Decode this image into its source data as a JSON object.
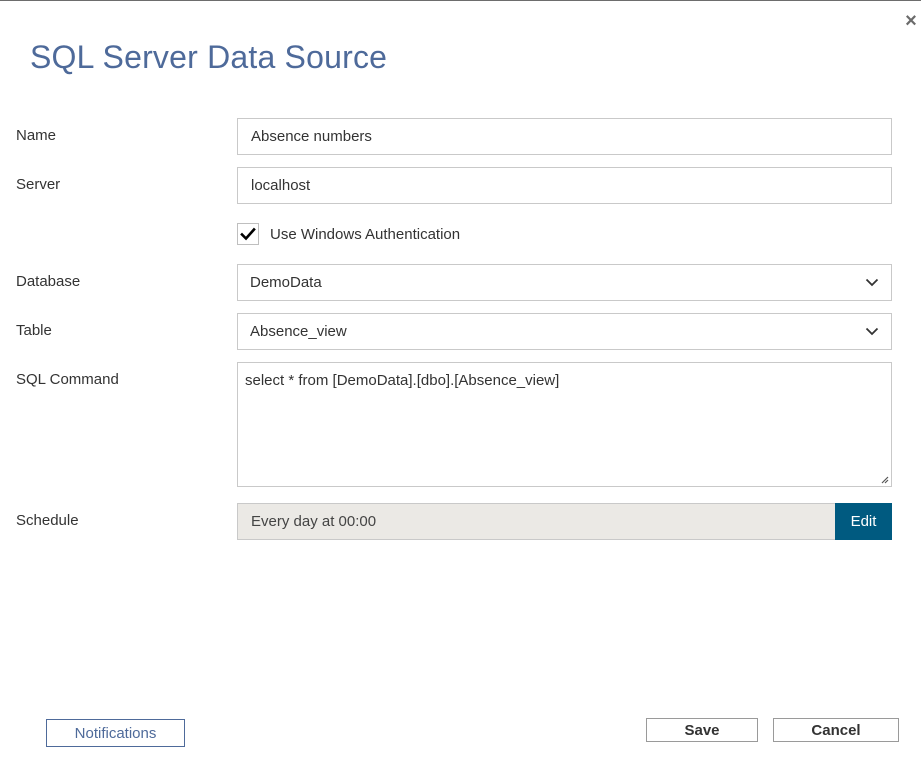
{
  "dialog": {
    "title": "SQL Server Data Source",
    "close_icon": "close-icon"
  },
  "form": {
    "name": {
      "label": "Name",
      "value": "Absence numbers"
    },
    "server": {
      "label": "Server",
      "value": "localhost"
    },
    "windows_auth": {
      "label": "Use Windows Authentication",
      "checked": true
    },
    "database": {
      "label": "Database",
      "selected": "DemoData"
    },
    "table": {
      "label": "Table",
      "selected": "Absence_view"
    },
    "sql_command": {
      "label": "SQL Command",
      "value": "select * from [DemoData].[dbo].[Absence_view]"
    },
    "schedule": {
      "label": "Schedule",
      "value": "Every day at 00:00",
      "edit_label": "Edit"
    }
  },
  "footer": {
    "notifications_label": "Notifications",
    "save_label": "Save",
    "cancel_label": "Cancel"
  },
  "colors": {
    "title": "#4e6a9a",
    "accent": "#005a80",
    "schedule_bg": "#ebe9e5"
  }
}
